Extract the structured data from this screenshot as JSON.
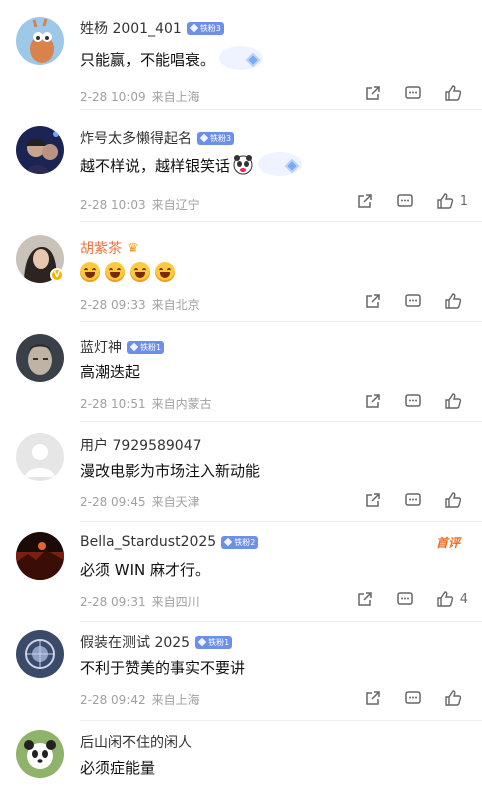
{
  "comments": [
    {
      "name": "姓杨 2001_401",
      "fan": "铁粉3",
      "text": "只能赢，不能唱衰。",
      "date": "2-28 10:09",
      "location": "来自上海",
      "likes": ""
    },
    {
      "name": "炸号太多懒得起名",
      "fan": "铁粉3",
      "text": "越不样说，越样银笑话",
      "date": "2-28 10:03",
      "location": "来自辽宁",
      "likes": "1"
    },
    {
      "name": "胡紫茶",
      "fan": "",
      "text": "",
      "date": "2-28 09:33",
      "location": "来自北京",
      "likes": ""
    },
    {
      "name": "蓝灯神",
      "fan": "铁粉1",
      "text": "高潮迭起",
      "date": "2-28 10:51",
      "location": "来自内蒙古",
      "likes": ""
    },
    {
      "name": "用户 7929589047",
      "fan": "",
      "text": "漫改电影为市场注入新动能",
      "date": "2-28 09:45",
      "location": "来自天津",
      "likes": ""
    },
    {
      "name": "Bella_Stardust2025",
      "fan": "铁粉2",
      "text": "必须 WIN 麻才行。",
      "date": "2-28 09:31",
      "location": "来自四川",
      "likes": "4",
      "tag": "首评"
    },
    {
      "name": "假装在测试 2025",
      "fan": "铁粉1",
      "text": "不利于赞美的事实不要讲",
      "date": "2-28 09:42",
      "location": "来自上海",
      "likes": ""
    },
    {
      "name": "后山闲不住的闲人",
      "fan": "",
      "text": "必须症能量",
      "date": "",
      "location": "",
      "likes": ""
    }
  ],
  "icons": {
    "share": "share-icon",
    "comment": "comment-icon",
    "like": "thumbs-up-icon",
    "verified": "verified-badge-icon",
    "crown": "crown-icon"
  },
  "colors": {
    "fan_badge": "#6d8fe8",
    "vip_name": "#eb7340",
    "first_review": "#f26a1b",
    "meta_gray": "#a0a0a0"
  }
}
